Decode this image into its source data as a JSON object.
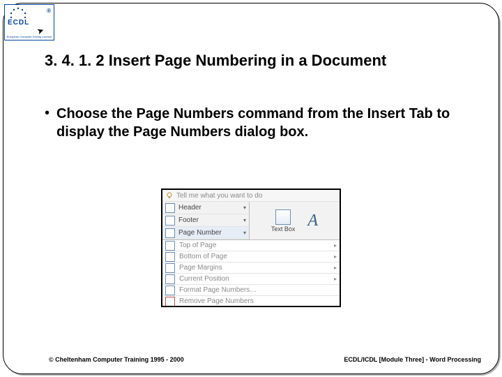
{
  "logo": {
    "mark": "ECDL",
    "registered": "®",
    "subtitle": "European Computer Driving Licence"
  },
  "title": "3. 4. 1. 2 Insert Page Numbering in a Document",
  "bullet": {
    "pre": "Choose the ",
    "bold1": "Page Numbers",
    "mid": " command from the ",
    "bold2": "Insert",
    "post": " Tab to display the Page Numbers dialog box."
  },
  "ribbon": {
    "tell_me": "Tell me what you want to do",
    "header": "Header",
    "footer": "Footer",
    "page_number": "Page Number",
    "text_box": "Text\nBox",
    "a_glyph": "A",
    "dd": "▾",
    "submenu": {
      "top": "Top of Page",
      "bottom": "Bottom of Page",
      "margins": "Page Margins",
      "current": "Current Position",
      "format": "Format Page Numbers…",
      "remove": "Remove Page Numbers",
      "arrow": "▸"
    }
  },
  "footer": {
    "left": "© Cheltenham Computer Training 1995 - 2000",
    "right": "ECDL/ICDL [Module Three] - Word Processing"
  }
}
